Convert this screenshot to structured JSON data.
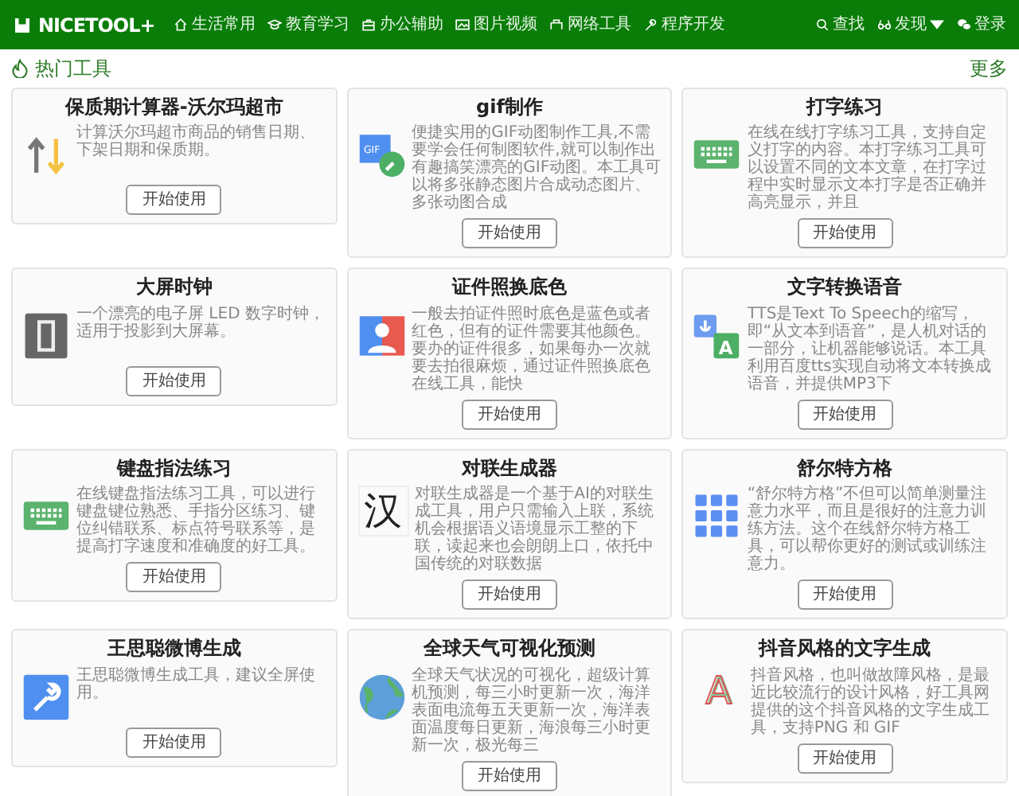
{
  "navbar": {
    "logo": "NICETOOL+",
    "menu": [
      {
        "label": "生活常用"
      },
      {
        "label": "教育学习"
      },
      {
        "label": "办公辅助"
      },
      {
        "label": "图片视频"
      },
      {
        "label": "网络工具"
      },
      {
        "label": "程序开发"
      }
    ],
    "right": [
      {
        "label": "查找",
        "dropdown": false
      },
      {
        "label": "发现",
        "dropdown": true
      },
      {
        "label": "登录",
        "dropdown": false
      }
    ]
  },
  "section": {
    "title": "热门工具",
    "more": "更多"
  },
  "tools": [
    {
      "title": "保质期计算器-沃尔玛超市",
      "description": "计算沃尔玛超市商品的销售日期、下架日期和保质期。",
      "button": "开始使用"
    },
    {
      "title": "gif制作",
      "icon_text": "GIF",
      "description": "便捷实用的GIF动图制作工具,不需要学会任何制图软件,就可以制作出有趣搞笑漂亮的GIF动图。本工具可以将多张静态图片合成动态图片、多张动图合成",
      "button": "开始使用"
    },
    {
      "title": "打字练习",
      "description": "在线在线打字练习工具，支持自定义打字的内容。本打字练习工具可以设置不同的文本文章，在打字过程中实时显示文本打字是否正确并高亮显示，并且",
      "button": "开始使用"
    },
    {
      "title": "大屏时钟",
      "description": "一个漂亮的电子屏 LED 数字时钟，适用于投影到大屏幕。",
      "button": "开始使用"
    },
    {
      "title": "证件照换底色",
      "description": "一般去拍证件照时底色是蓝色或者红色，但有的证件需要其他颜色。要办的证件很多，如果每办一次就要去拍很麻烦，通过证件照换底色在线工具，能快",
      "button": "开始使用"
    },
    {
      "title": "文字转换语音",
      "icon_text": "A",
      "description": "TTS是Text To Speech的缩写，即“从文本到语音”，是人机对话的一部分，让机器能够说话。本工具利用百度tts实现自动将文本转换成语音，并提供MP3下",
      "button": "开始使用"
    },
    {
      "title": "键盘指法练习",
      "description": "在线键盘指法练习工具，可以进行键盘键位熟悉、手指分区练习、键位纠错联系、标点符号联系等，是提高打字速度和准确度的好工具。",
      "button": "开始使用"
    },
    {
      "title": "对联生成器",
      "icon_text": "汉",
      "description": "对联生成器是一个基于AI的对联生成工具，用户只需输入上联，系统机会根据语义语境显示工整的下联，读起来也会朗朗上口，依托中国传统的对联数据",
      "button": "开始使用"
    },
    {
      "title": "舒尔特方格",
      "description": "“舒尔特方格”不但可以简单测量注意力水平，而且是很好的注意力训练方法。这个在线舒尔特方格工具，可以帮你更好的测试或训练注意力。",
      "button": "开始使用"
    },
    {
      "title": "王思聪微博生成",
      "description": "王思聪微博生成工具，建议全屏使用。",
      "button": "开始使用"
    },
    {
      "title": "全球天气可视化预测",
      "description": "全球天气状况的可视化，超级计算机预测，每三小时更新一次，海洋表面电流每五天更新一次，海洋表面温度每日更新，海浪每三小时更新一次，极光每三",
      "button": "开始使用"
    },
    {
      "title": "抖音风格的文字生成",
      "icon_text": "A",
      "description": "抖音风格，也叫做故障风格，是最近比较流行的设计风格，好工具网提供的这个抖音风格的文字生成工具，支持PNG 和 GIF",
      "button": "开始使用"
    }
  ]
}
